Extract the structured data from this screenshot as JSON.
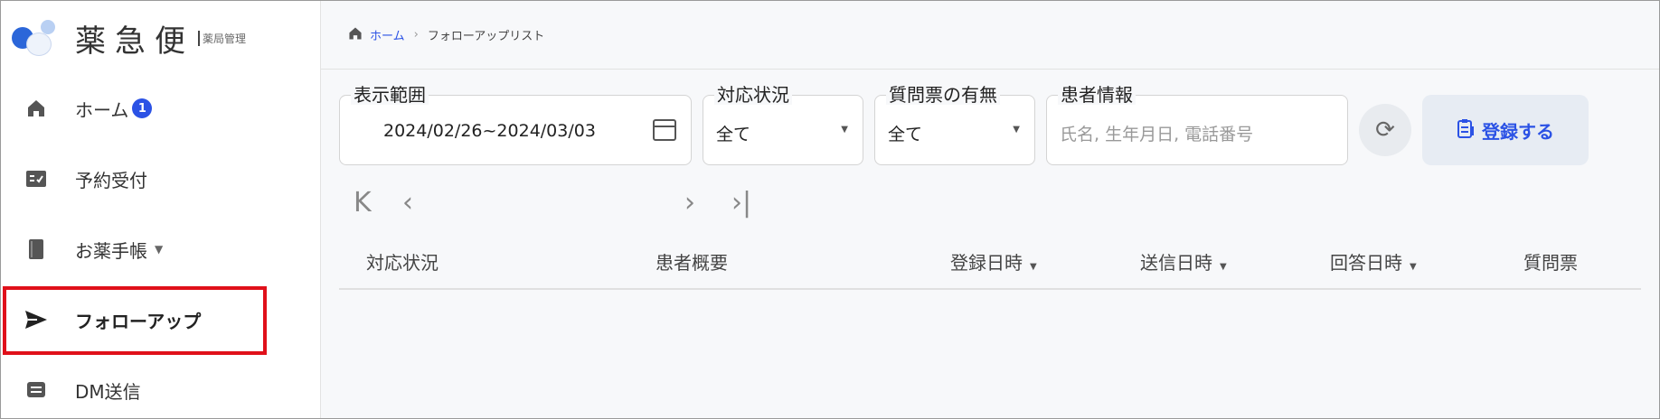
{
  "app": {
    "logo_text": "薬急便",
    "logo_sub": "薬局管理"
  },
  "sidebar": {
    "items": [
      {
        "label": "ホーム",
        "badge": "1",
        "icon": "home-icon"
      },
      {
        "label": "予約受付",
        "icon": "reservation-icon"
      },
      {
        "label": "お薬手帳",
        "icon": "medicine-book-icon",
        "has_caret": true
      },
      {
        "label": "フォローアップ",
        "icon": "send-icon",
        "active": true
      },
      {
        "label": "DM送信",
        "icon": "message-icon"
      }
    ]
  },
  "breadcrumb": {
    "home": "ホーム",
    "current": "フォローアップリスト"
  },
  "filters": {
    "range_label": "表示範囲",
    "range_value": "2024/02/26~2024/03/03",
    "status_label": "対応状況",
    "status_value": "全て",
    "questionnaire_label": "質問票の有無",
    "questionnaire_value": "全て",
    "patient_label": "患者情報",
    "patient_placeholder": "氏名, 生年月日, 電話番号"
  },
  "actions": {
    "register_label": "登録する"
  },
  "table": {
    "columns": [
      "対応状況",
      "患者概要",
      "登録日時",
      "送信日時",
      "回答日時",
      "質問票"
    ]
  },
  "colors": {
    "accent": "#2b52e5",
    "highlight_box": "#e0101a"
  }
}
